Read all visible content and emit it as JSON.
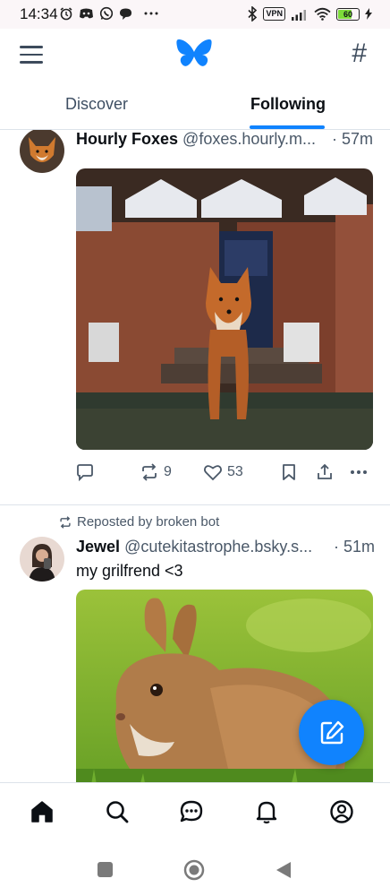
{
  "status_bar": {
    "time": "14:34",
    "vpn_label": "VPN",
    "battery_label": "60",
    "left_icons": [
      "alarm-icon",
      "discord-icon",
      "whatsapp-icon",
      "chat-icon",
      "more-dots-icon"
    ],
    "right_icons": [
      "bluetooth-icon",
      "vpn-icon",
      "signal-icon",
      "wifi-icon",
      "battery-icon",
      "charging-icon"
    ]
  },
  "header": {
    "menu_icon": "hamburger-menu-icon",
    "logo_icon": "butterfly-logo-icon",
    "feeds_icon": "hashtag-icon",
    "tabs": [
      {
        "label": "Discover",
        "active": false
      },
      {
        "label": "Following",
        "active": true
      }
    ]
  },
  "colors": {
    "accent": "#1083fe",
    "text_primary": "#0b0f14",
    "text_secondary": "#4a5868",
    "divider": "#dde3ea"
  },
  "posts": [
    {
      "author": "Hourly Foxes",
      "handle": "@foxes.hourly.m...",
      "time": "· 57m",
      "image": "photo of a red fox standing in front of a brick house doorway",
      "reposts": "9",
      "likes": "53"
    },
    {
      "repost_label": "Reposted by broken bot",
      "author": "Jewel",
      "handle": "@cutekitastrophe.bsky.s...",
      "time": "· 51m",
      "text": "my grilfrend <3",
      "image": "photo of a brown rabbit on green grass"
    }
  ],
  "fab": {
    "icon": "compose-icon"
  },
  "bottom_nav": {
    "items": [
      "home-icon",
      "search-icon",
      "chat-icon",
      "notifications-bell-icon",
      "profile-icon"
    ]
  },
  "system_nav": {
    "items": [
      "recents-square-icon",
      "home-circle-icon",
      "back-triangle-icon"
    ]
  }
}
